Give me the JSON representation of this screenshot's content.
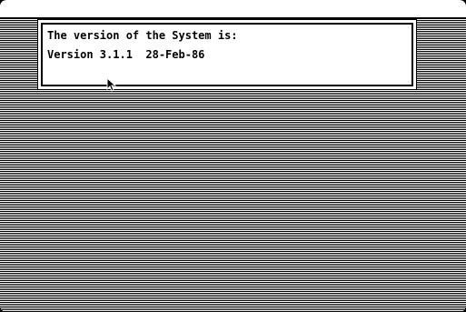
{
  "dialog": {
    "line1": "The version of the System is:",
    "line2": "Version 3.1.1  28-Feb-86"
  },
  "icons": {
    "cursor": "arrow-pointer-icon"
  },
  "colors": {
    "foreground": "#000000",
    "background": "#ffffff"
  }
}
